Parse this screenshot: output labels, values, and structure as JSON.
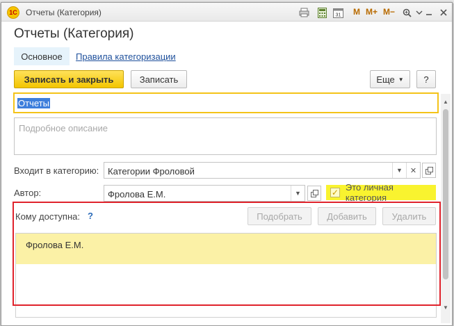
{
  "window": {
    "title": "Отчеты (Категория)",
    "logo": "1С",
    "toolbar_icons": [
      "print-icon",
      "calculator-icon",
      "calendar-icon"
    ],
    "calendar_day": "31",
    "memory_buttons": [
      "M",
      "M+",
      "M−"
    ],
    "controls": [
      "zoom-icon",
      "menu-icon",
      "minimize-icon",
      "restore-icon",
      "close-icon"
    ]
  },
  "form": {
    "heading": "Отчеты (Категория)",
    "tabs": [
      {
        "label": "Основное",
        "active": true
      },
      {
        "label": "Правила категоризации",
        "active": false
      }
    ]
  },
  "toolbar": {
    "save_close_label": "Записать и закрыть",
    "save_label": "Записать",
    "more_label": "Еще",
    "help_label": "?"
  },
  "fields": {
    "name_value": "Отчеты",
    "description_placeholder": "Подробное описание",
    "parent_label": "Входит в категорию:",
    "parent_value": "Категории Фроловой",
    "author_label": "Автор:",
    "author_value": "Фролова Е.М.",
    "personal_label": "Это личная категория",
    "personal_checked": true
  },
  "access": {
    "label": "Кому доступна:",
    "help": "?",
    "pick_label": "Подобрать",
    "add_label": "Добавить",
    "delete_label": "Удалить",
    "users": [
      "Фролова Е.М."
    ]
  },
  "colors": {
    "accent_yellow": "#f3c500",
    "highlight_red": "#e0222b",
    "selection_row": "#fbf1a6",
    "link_blue": "#1d4f9b"
  }
}
